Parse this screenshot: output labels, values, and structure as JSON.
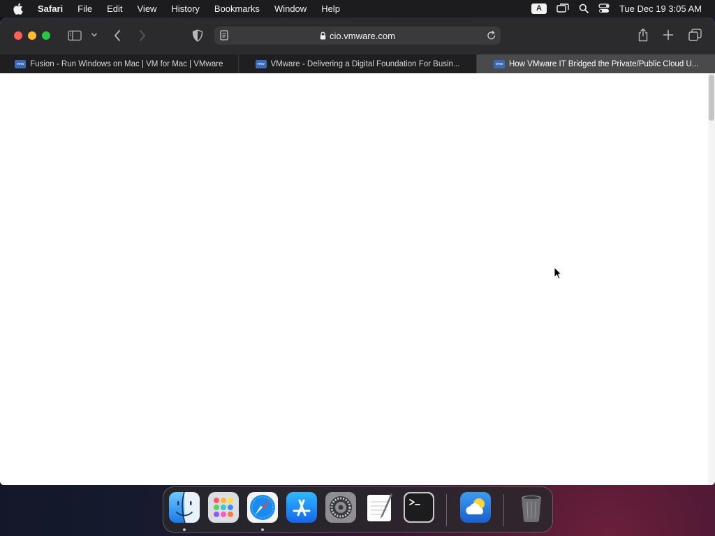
{
  "menubar": {
    "app_name": "Safari",
    "items": [
      "File",
      "Edit",
      "View",
      "History",
      "Bookmarks",
      "Window",
      "Help"
    ],
    "input_source": "A",
    "clock": "Tue Dec 19  3:05 AM"
  },
  "browser": {
    "url": "cio.vmware.com",
    "tabs": [
      {
        "title": "Fusion - Run Windows on Mac | VM for Mac | VMware",
        "favicon": "vmware",
        "active": false
      },
      {
        "title": "VMware - Delivering a Digital Foundation For Busin...",
        "favicon": "vmware",
        "active": false
      },
      {
        "title": "How VMware IT Bridged the Private/Public Cloud U...",
        "favicon": "vmware",
        "active": true
      }
    ],
    "favicon_text": "vmw"
  },
  "dock": {
    "apps": [
      "finder",
      "launchpad",
      "safari",
      "app-store",
      "system-preferences",
      "textedit",
      "terminal",
      "weather",
      "trash"
    ]
  },
  "colors": {
    "close": "#ff5f57",
    "minimize": "#febc2e",
    "maximize": "#28c840",
    "toolbar": "#2b2b2d",
    "active_tab": "#4a4a4c"
  }
}
